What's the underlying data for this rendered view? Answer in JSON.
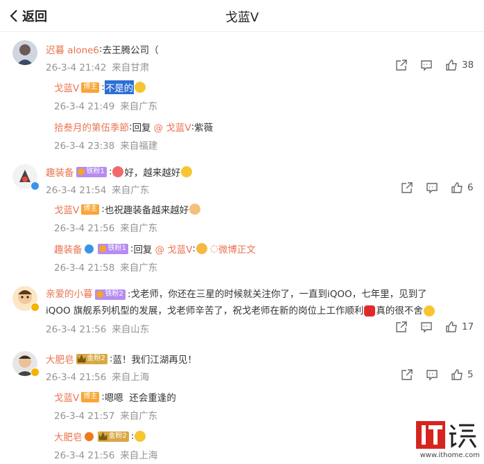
{
  "header": {
    "back_label": "返回",
    "title": "戈蓝V"
  },
  "comments": [
    {
      "user": "迟暮 alone6",
      "text": "去王腾公司（",
      "time": "26-3-4 21:42",
      "location": "来自甘肃",
      "likes": "38",
      "replies": [
        {
          "user": "戈蓝V",
          "badge": "博主",
          "text": "不是的",
          "time": "26-3-4 21:49",
          "location": "来自广东"
        },
        {
          "user": "拾叁月的第伍季節",
          "reply_word": "回复",
          "reply_to": "@ 戈蓝V",
          "text": "紫薇",
          "time": "26-3-4 23:38",
          "location": "来自福建"
        }
      ]
    },
    {
      "user": "趣装备",
      "fan_badge": "铁粉1",
      "text": "好，越来越好",
      "time": "26-3-4 21:54",
      "location": "来自广东",
      "likes": "6",
      "replies": [
        {
          "user": "戈蓝V",
          "badge": "博主",
          "text": "也祝趣装备越来越好",
          "time": "26-3-4 21:56",
          "location": "来自广东"
        },
        {
          "user": "趣装备",
          "fan_badge": "铁粉1",
          "reply_word": "回复",
          "reply_to": "@ 戈蓝V",
          "link": "微博正文",
          "time": "26-3-4 21:58",
          "location": "来自广东"
        }
      ]
    },
    {
      "user": "亲爱的小暮",
      "fan_badge": "铁粉2",
      "text_line1": "戈老师，你还在三星的时候就关注你了，一直到iQOO，七年里，见到了",
      "text_line2": "iQOO 旗舰系列机型的发展，戈老师辛苦了，祝戈老师在新的岗位上工作顺利",
      "text_end": "真的很不舍",
      "time": "26-3-4 21:56",
      "location": "来自山东",
      "likes": "17"
    },
    {
      "user": "大肥皂",
      "gold_badge": "金粉2",
      "text": "蓝！我们江湖再见！",
      "time": "26-3-4 21:56",
      "location": "来自上海",
      "likes": "5",
      "replies": [
        {
          "user": "戈蓝V",
          "badge": "博主",
          "text": "嗯嗯  还会重逢的",
          "time": "26-3-4 21:57",
          "location": "来自广东"
        },
        {
          "user": "大肥皂",
          "gold_badge": "金粉2",
          "time": "26-3-4 21:56",
          "location": "来自上海"
        }
      ]
    }
  ],
  "watermark": {
    "site": "www.ithome.com"
  }
}
